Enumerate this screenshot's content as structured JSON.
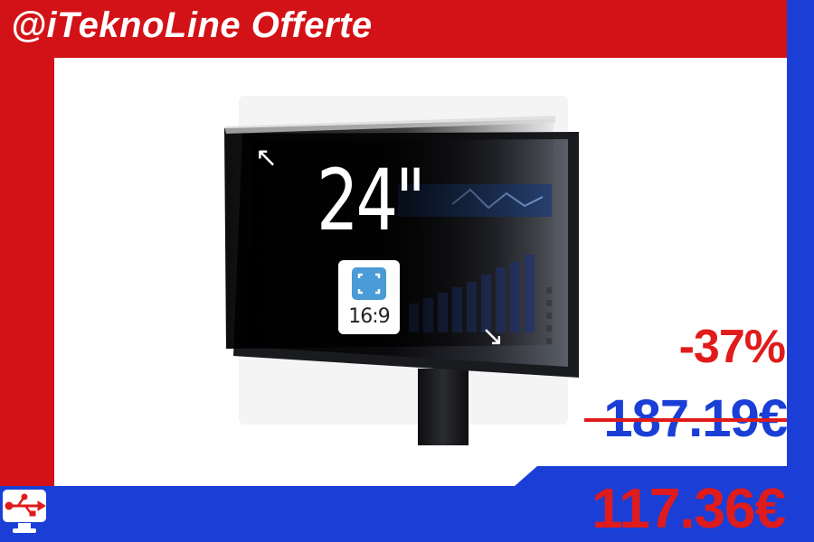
{
  "header": {
    "title": "@iTeknoLine Offerte"
  },
  "product": {
    "size_label": "24\"",
    "aspect_ratio": "16:9",
    "icons": [
      "expand-arrow-top-left-icon",
      "expand-arrow-bottom-right-icon",
      "aspect-ratio-icon",
      "usb-monitor-logo-icon"
    ]
  },
  "pricing": {
    "discount": "-37%",
    "old_price": "187.19€",
    "new_price": "117.36€"
  },
  "colors": {
    "brand_red": "#d31217",
    "brand_blue": "#1b3fd6",
    "price_red": "#e01b1b"
  }
}
